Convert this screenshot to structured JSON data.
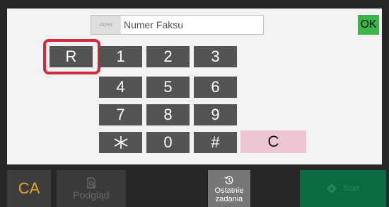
{
  "address_bar": {
    "address_button": "Adres",
    "fax_number_placeholder": "Numer Faksu",
    "fax_number_value": ""
  },
  "ok_button": "OK",
  "keypad": {
    "r_key": "R",
    "keys": [
      "1",
      "2",
      "3",
      "4",
      "5",
      "6",
      "7",
      "8",
      "9",
      "⁎",
      "0",
      "#"
    ],
    "clear_key": "C"
  },
  "bottom_bar": {
    "ca_button": "CA",
    "preview_button": "Podgląd",
    "recent_jobs_button": [
      "Ostatnie",
      "zadania"
    ],
    "start_button": "Start"
  },
  "colors": {
    "ok": "#3cb44a",
    "highlight": "#d4283c",
    "clear": "#ecc5d1",
    "ca_text": "#e6a422",
    "start_bg": "#0a6a42"
  },
  "icons": {
    "preview": "document-magnifier-icon",
    "recent_jobs": "clock-history-icon",
    "start": "diamond-start-icon",
    "asterisk": "asterisk-icon"
  }
}
